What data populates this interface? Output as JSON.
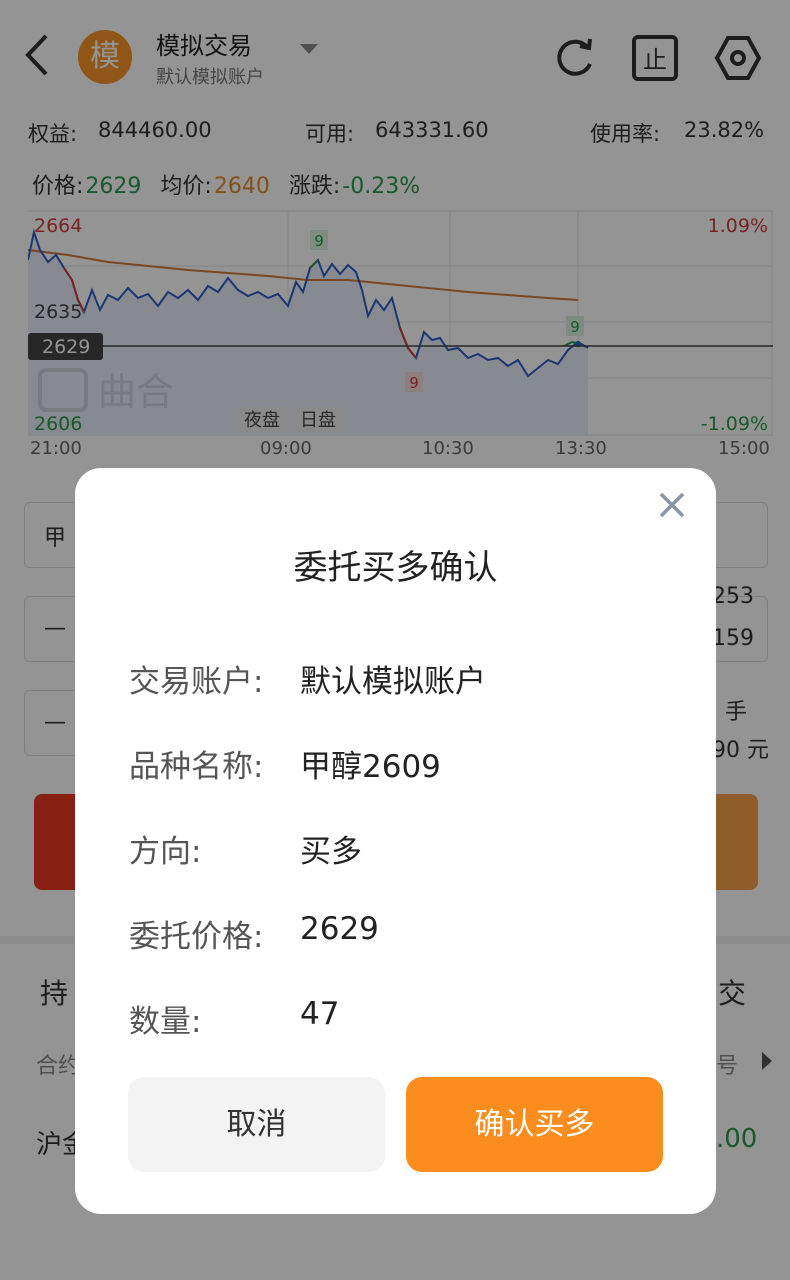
{
  "header": {
    "back_icon": "chevron-left-icon",
    "avatar_text": "模",
    "title": "模拟交易",
    "subtitle": "默认模拟账户",
    "icons": [
      "refresh-icon",
      "stop-icon",
      "settings-icon"
    ]
  },
  "account": {
    "equity_label": "权益:",
    "equity_value": "844460.00",
    "available_label": "可用:",
    "available_value": "643331.60",
    "usage_label": "使用率:",
    "usage_value": "23.82%"
  },
  "quote": {
    "price_label": "价格:",
    "price_value": "2629",
    "avg_label": "均价:",
    "avg_value": "2640",
    "change_label": "涨跌:",
    "change_value": "-0.23%"
  },
  "chart": {
    "high_price": "2664",
    "mid_price": "2635",
    "cur_price": "2629",
    "low_price": "2606",
    "high_pct": "1.09%",
    "low_pct": "-1.09%",
    "marker_top": "9",
    "marker_right": "9",
    "marker_bottom": "9",
    "session_night": "夜盘",
    "session_day": "日盘",
    "watermark": "曲合",
    "x_labels": [
      "21:00",
      "09:00",
      "10:30",
      "13:30",
      "15:00"
    ],
    "colors": {
      "price_line": "#2f5fc4",
      "avg_line": "#d07a3a",
      "up": "#d23b3b",
      "down": "#2a9a4a"
    }
  },
  "background_form": {
    "row1_left": "甲",
    "row2_left": "—",
    "row3_left": "—",
    "right_1": "253",
    "right_2": "159",
    "right_3": "手",
    "right_4": "90 元",
    "holdings_label": "持",
    "trade_label": "交",
    "contract_label": "合约",
    "seq_label": "号",
    "exchange_label": "沪金",
    "amount_right": ".00"
  },
  "modal": {
    "title": "委托买多确认",
    "close_icon": "close-icon",
    "rows": [
      {
        "key": "交易账户:",
        "value": "默认模拟账户"
      },
      {
        "key": "品种名称:",
        "value": "甲醇2609"
      },
      {
        "key": "方向:",
        "value": "买多"
      },
      {
        "key": "委托价格:",
        "value": "2629"
      },
      {
        "key": "数量:",
        "value": "47"
      }
    ],
    "cancel_label": "取消",
    "confirm_label": "确认买多"
  }
}
